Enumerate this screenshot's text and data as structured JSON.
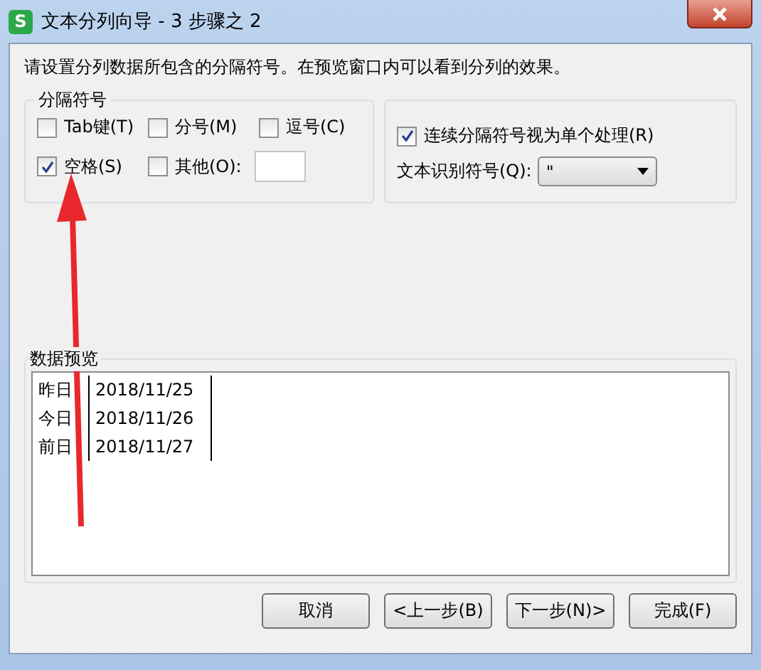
{
  "window": {
    "title": "文本分列向导 - 3 步骤之 2",
    "app_icon": "S"
  },
  "instruction": "请设置分列数据所包含的分隔符号。在预览窗口内可以看到分列的效果。",
  "delimiters": {
    "title": "分隔符号",
    "items": [
      {
        "label": "Tab键(T)",
        "checked": false
      },
      {
        "label": "分号(M)",
        "checked": false
      },
      {
        "label": "逗号(C)",
        "checked": false
      },
      {
        "label": "空格(S)",
        "checked": true
      },
      {
        "label": "其他(O):",
        "checked": false,
        "kind": "other"
      }
    ]
  },
  "options": {
    "consecutive": {
      "label": "连续分隔符号视为单个处理(R)",
      "checked": true
    },
    "qualifier": {
      "label": "文本识别符号(Q):",
      "value": "\""
    }
  },
  "preview": {
    "title": "数据预览",
    "rows": [
      [
        "昨日",
        "2018/11/25"
      ],
      [
        "今日",
        "2018/11/26"
      ],
      [
        "前日",
        "2018/11/27"
      ]
    ]
  },
  "buttons": [
    "取消",
    "<上一步(B)",
    "下一步(N)>",
    "完成(F)"
  ]
}
